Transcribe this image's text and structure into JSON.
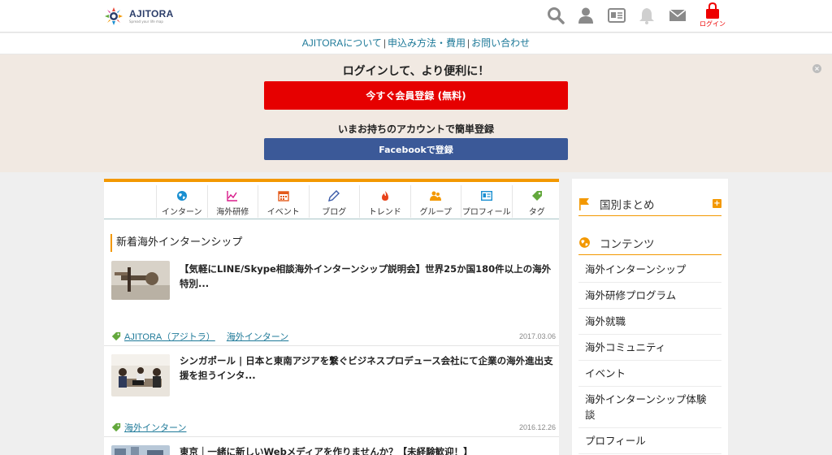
{
  "header": {
    "logo_name": "AJITORA",
    "logo_tagline": "Spread your life map",
    "login_label": "ログイン"
  },
  "subnav": {
    "about": "AJITORAについて",
    "apply": "申込み方法・費用",
    "contact": "お問い合わせ",
    "separator": "|"
  },
  "promo": {
    "title": "ログインして、より便利に！",
    "register_label": "今すぐ会員登録 (無料)",
    "subtitle": "いまお持ちのアカウントで簡単登録",
    "facebook_label": "Facebookで登録",
    "close": "×"
  },
  "tabs": [
    {
      "label": "インターン",
      "icon": "globe-icon",
      "color": "#1a8fd1"
    },
    {
      "label": "海外研修",
      "icon": "chart-icon",
      "color": "#d81b8a"
    },
    {
      "label": "イベント",
      "icon": "calendar-icon",
      "color": "#e35a1b"
    },
    {
      "label": "ブログ",
      "icon": "pen-icon",
      "color": "#3a5aa8"
    },
    {
      "label": "トレンド",
      "icon": "flame-icon",
      "color": "#e8431b"
    },
    {
      "label": "グループ",
      "icon": "group-icon",
      "color": "#f39800"
    },
    {
      "label": "プロフィール",
      "icon": "id-card-icon",
      "color": "#1a8fd1"
    },
    {
      "label": "タグ",
      "icon": "tag-icon",
      "color": "#63a83c"
    }
  ],
  "main": {
    "section_title": "新着海外インターンシップ",
    "articles": [
      {
        "title": "【気軽にLINE/Skype相談海外インターンシップ説明会】世界25か国180件以上の海外特別...",
        "tags": [
          "AJITORA（アジトラ）",
          "海外インターン"
        ],
        "date": "2017.03.06"
      },
      {
        "title": "シンガポール | 日本と東南アジアを繋ぐビジネスプロデュース会社にて企業の海外進出支援を担うインタ...",
        "tags": [
          "海外インターン"
        ],
        "date": "2016.12.26"
      },
      {
        "title": "東京｜一緒に新しいWebメディアを作りませんか？【未経験歓迎！】",
        "tags": [],
        "date": ""
      }
    ]
  },
  "sidebar": {
    "country_heading": "国別まとめ",
    "country_plus": "+",
    "contents_heading": "コンテンツ",
    "items": [
      "海外インターンシップ",
      "海外研修プログラム",
      "海外就職",
      "海外コミュニティ",
      "イベント",
      "海外インターンシップ体験談",
      "プロフィール"
    ]
  },
  "colors": {
    "accent": "#f39800",
    "register": "#e60000",
    "facebook": "#3b5998",
    "link": "#1f7a99",
    "promo_bg": "#f1e9e2"
  }
}
